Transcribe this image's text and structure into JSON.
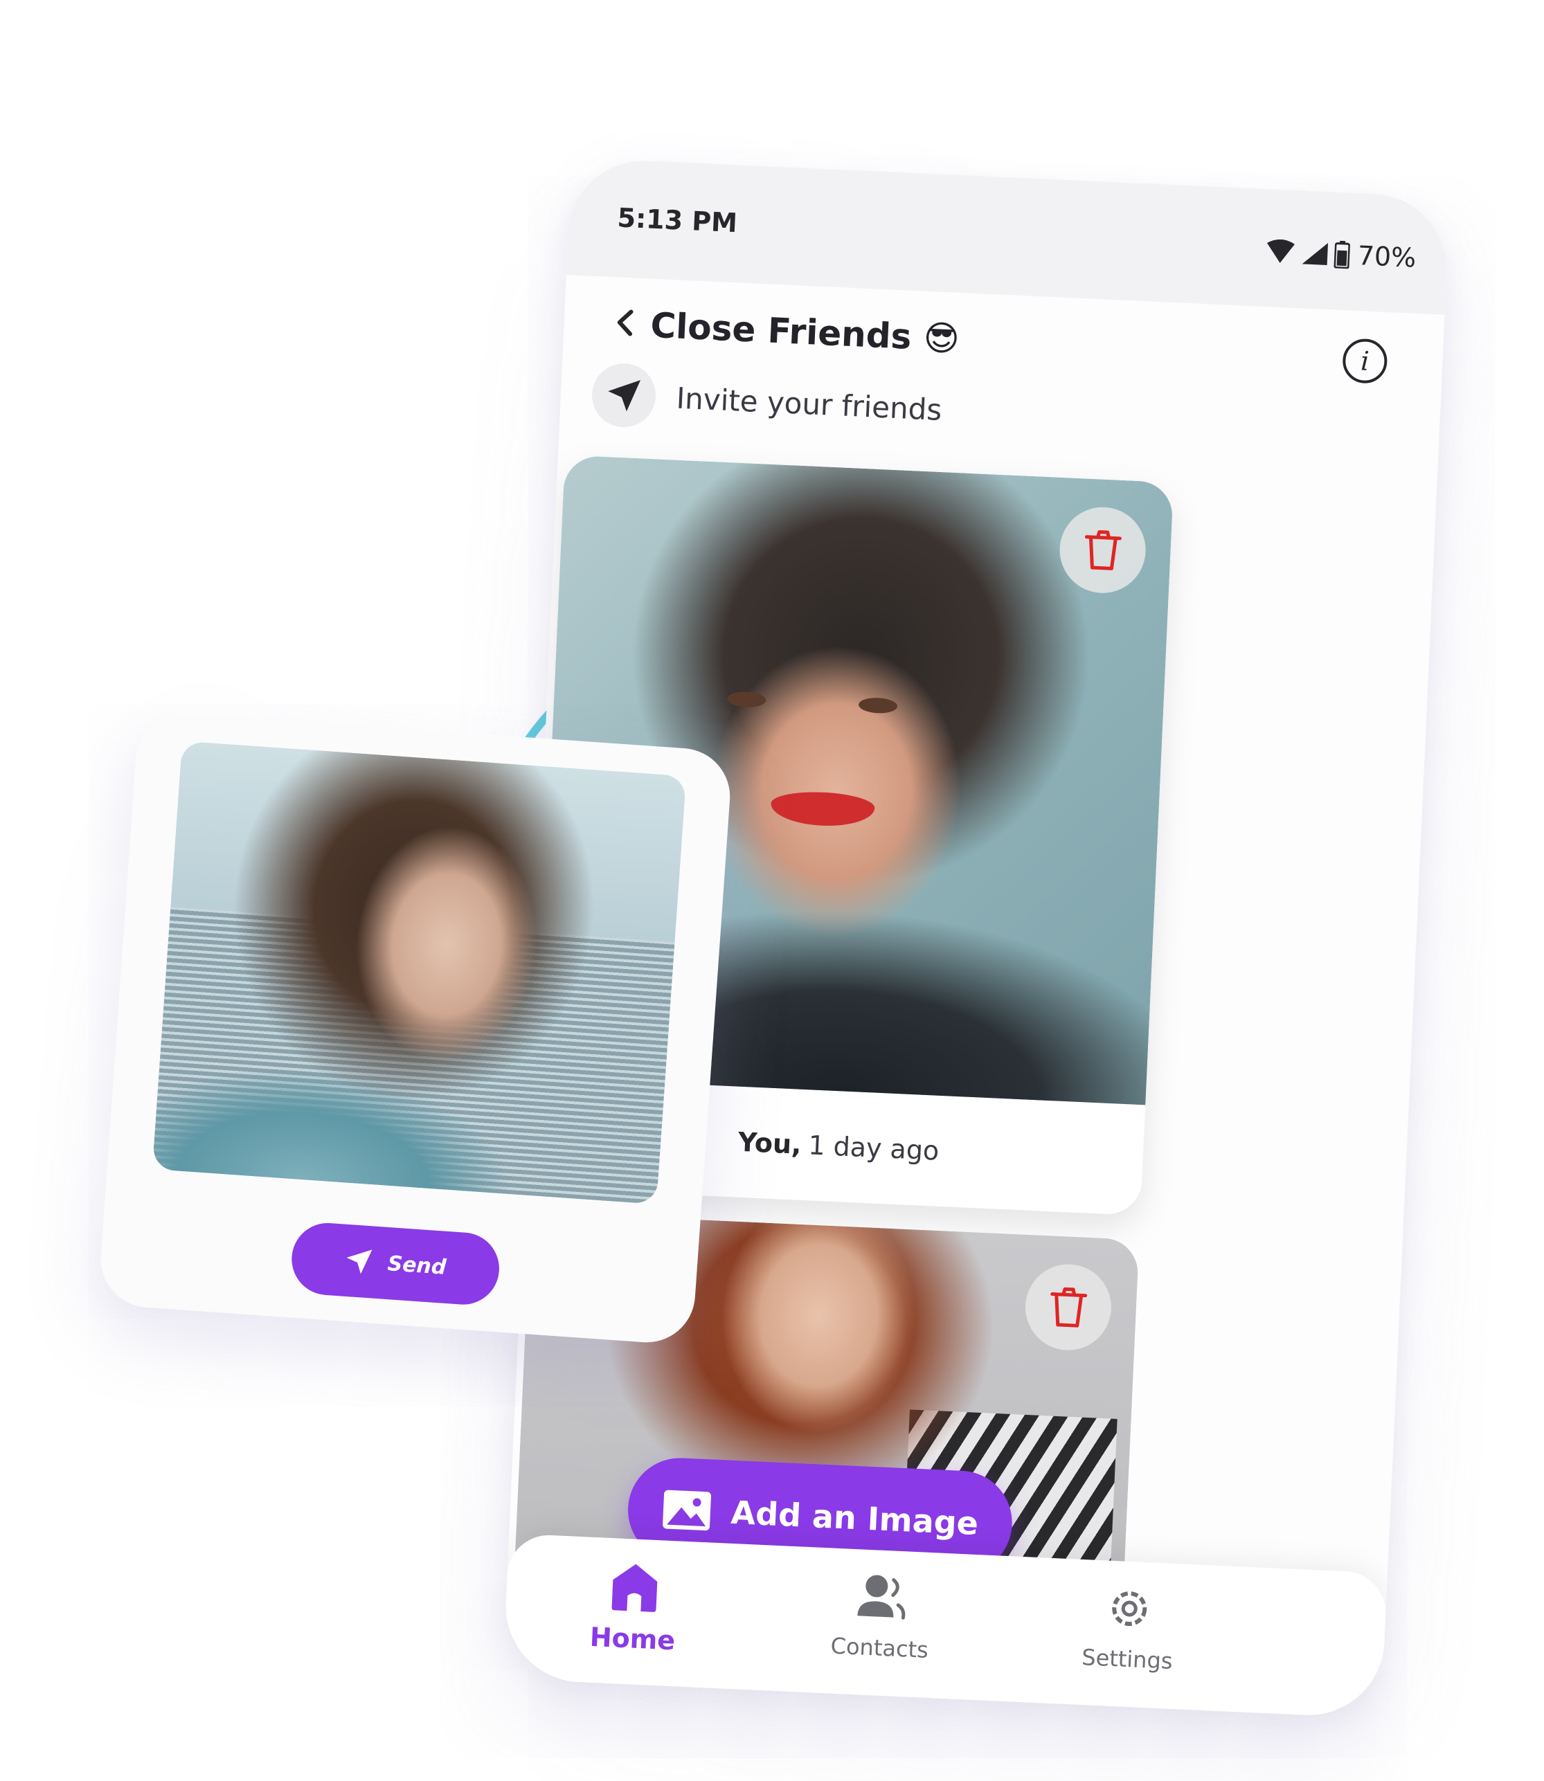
{
  "status_bar": {
    "time": "5:13 PM",
    "battery": "70%",
    "icons": [
      "wifi-icon",
      "signal-icon",
      "battery-icon"
    ]
  },
  "header": {
    "title": "Close Friends 😎",
    "back_icon": "chevron-left-icon",
    "info_icon": "info-icon"
  },
  "invite": {
    "label": "Invite your friends",
    "icon": "send-arrow-icon"
  },
  "posts": [
    {
      "author": "You,",
      "time": "1 day ago",
      "delete_icon": "trash-icon"
    },
    {
      "delete_icon": "trash-icon"
    }
  ],
  "add_image": {
    "label": "Add an Image",
    "icon": "image-icon"
  },
  "nav": [
    {
      "label": "Home",
      "icon": "home-icon",
      "active": true
    },
    {
      "label": "Contacts",
      "icon": "contacts-icon",
      "active": false
    },
    {
      "label": "Settings",
      "icon": "gear-icon",
      "active": false
    }
  ],
  "floating_card": {
    "send_label": "Send",
    "send_icon": "send-icon"
  },
  "colors": {
    "accent": "#8a3ae6",
    "danger": "#e02424",
    "arrow": "#5ccfe0"
  }
}
